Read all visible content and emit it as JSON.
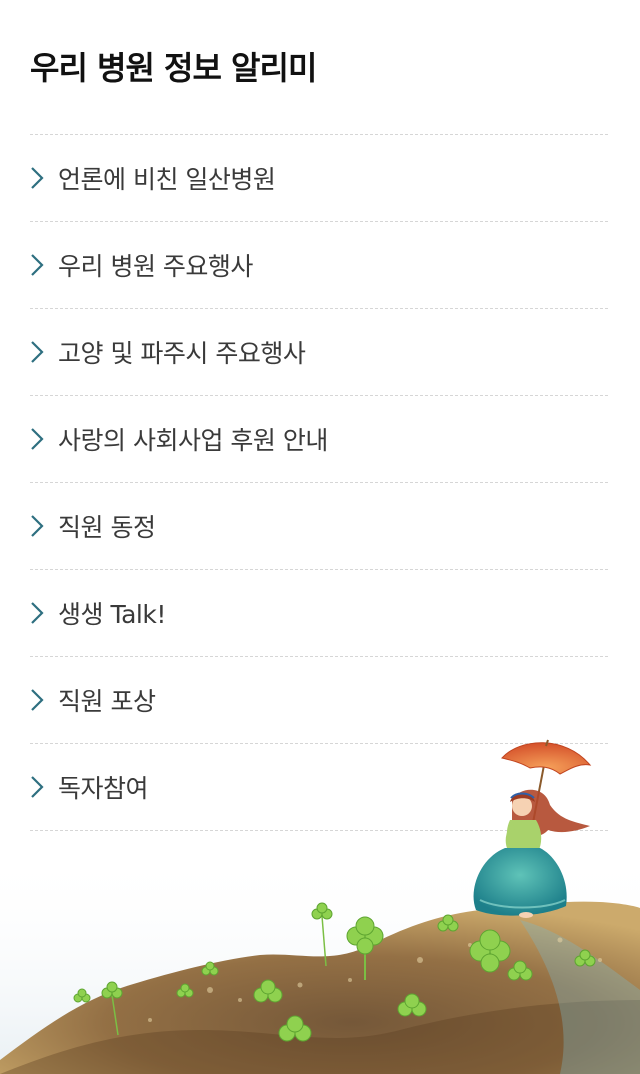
{
  "header": {
    "title": "우리 병원 정보 알리미"
  },
  "menu": {
    "items": [
      {
        "label": "언론에 비친 일산병원"
      },
      {
        "label": "우리 병원 주요행사"
      },
      {
        "label": "고양 및 파주시 주요행사"
      },
      {
        "label": "사랑의 사회사업 후원 안내"
      },
      {
        "label": "직원 동정"
      },
      {
        "label": "생생 Talk!"
      },
      {
        "label": "직원 포상"
      },
      {
        "label": "독자참여"
      }
    ],
    "icon": "chevron-right-icon"
  },
  "colors": {
    "title": "#111111",
    "label": "#3a3a3a",
    "chevron": "#2e6f80",
    "divider": "#d6d6d6"
  },
  "illustration": {
    "icon": "girl-with-umbrella-on-hill-illustration"
  }
}
